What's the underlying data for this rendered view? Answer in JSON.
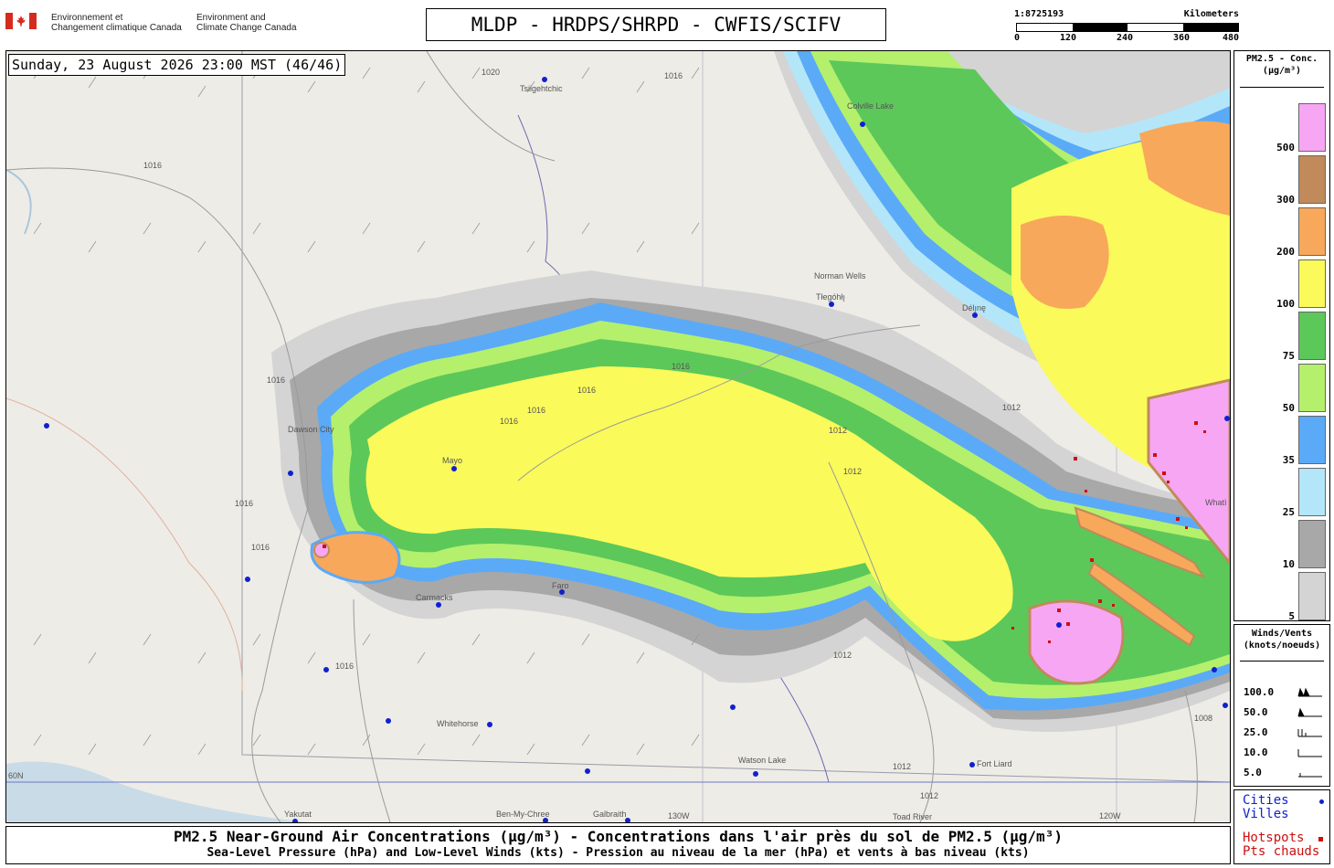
{
  "header": {
    "org_fr_line1": "Environnement et",
    "org_fr_line2": "Changement climatique Canada",
    "org_en_line1": "Environment and",
    "org_en_line2": "Climate Change Canada",
    "title": "MLDP - HRDPS/SHRPD - CWFIS/SCIFV"
  },
  "scale": {
    "ratio": "1:8725193",
    "unit": "Kilometers",
    "ticks": [
      "0",
      "120",
      "240",
      "360",
      "480"
    ]
  },
  "map": {
    "datetime": "Sunday, 23 August 2026 23:00 MST (46/46)",
    "places": [
      "Tsiigehtchic",
      "Colville Lake",
      "Norman Wells",
      "Tłegóhłı̨",
      "Délı̨nę",
      "Dawson City",
      "Mayo",
      "Carmacks",
      "Faro",
      "Whitehorse",
      "Watson Lake",
      "Fort Liard",
      "Whatì",
      "Yakutat",
      "Ben-My-Chree",
      "Galbraith",
      "Toad River"
    ],
    "isobar_labels": [
      "1020",
      "1016",
      "1016",
      "1016",
      "1016",
      "1016",
      "1016",
      "1016",
      "1016",
      "1016",
      "1012",
      "1012",
      "1012",
      "1012",
      "1012",
      "1012",
      "1008",
      "1016"
    ],
    "graticule_labels": [
      "60N",
      "130W",
      "120W"
    ]
  },
  "legend": {
    "title_line1": "PM2.5 - Conc.",
    "title_line2": "(µg/m³)",
    "levels": [
      {
        "label": "500",
        "color": "#f7a6f3"
      },
      {
        "label": "300",
        "color": "#c08a5a"
      },
      {
        "label": "200",
        "color": "#f8a85a"
      },
      {
        "label": "100",
        "color": "#fafa5a"
      },
      {
        "label": "75",
        "color": "#5cc85a"
      },
      {
        "label": "50",
        "color": "#b4f06c"
      },
      {
        "label": "35",
        "color": "#5aaaf8"
      },
      {
        "label": "25",
        "color": "#b4e6fa"
      },
      {
        "label": "10",
        "color": "#a8a8a8"
      },
      {
        "label": "5",
        "color": "#d4d4d4"
      }
    ]
  },
  "winds": {
    "title_line1": "Winds/Vents",
    "title_line2": "(knots/noeuds)",
    "rows": [
      "100.0",
      "50.0",
      "25.0",
      "10.0",
      "5.0"
    ]
  },
  "keys": {
    "cities_en": "Cities",
    "cities_fr": "Villes",
    "cities_color": "#1020d0",
    "hotspots_en": "Hotspots",
    "hotspots_fr": "Pts chauds",
    "hotspots_color": "#cc1010"
  },
  "captions": {
    "line1": "PM2.5 Near-Ground Air Concentrations (µg/m³) - Concentrations dans l'air près du sol de PM2.5 (µg/m³)",
    "line2": "Sea-Level Pressure (hPa) and Low-Level Winds (kts) - Pression au niveau de la mer (hPa) et vents à bas niveau (kts)"
  }
}
